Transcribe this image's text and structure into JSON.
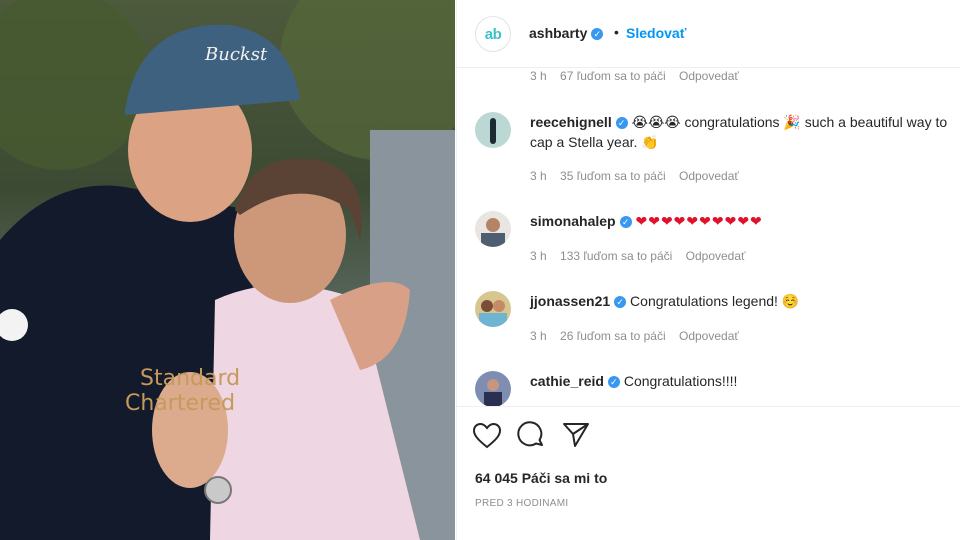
{
  "post": {
    "username": "ashbarty",
    "avatar_text": "ab",
    "separator": "•",
    "follow_label": "Sledovať"
  },
  "first_meta": {
    "time": "3 h",
    "likes": "67 ľuďom sa to páči",
    "reply": "Odpovedať"
  },
  "comments": [
    {
      "username": "reecehignell",
      "text": "😭😭😭 congratulations 🎉 such a beautiful way to cap a Stella year. 👏",
      "time": "3 h",
      "likes": "35 ľuďom sa to páči",
      "reply": "Odpovedať"
    },
    {
      "username": "simonahalep",
      "text": "❤❤❤❤❤❤❤❤❤❤",
      "time": "3 h",
      "likes": "133 ľuďom sa to páči",
      "reply": "Odpovedať"
    },
    {
      "username": "jjonassen21",
      "text": "Congratulations legend! ☺️",
      "time": "3 h",
      "likes": "26 ľuďom sa to páči",
      "reply": "Odpovedať"
    },
    {
      "username": "cathie_reid",
      "text": "Congratulations!!!!"
    }
  ],
  "actions": {
    "like_icon": "heart-icon",
    "comment_icon": "comment-icon",
    "share_icon": "share-icon"
  },
  "likes_total": "64 045 Páči sa mi to",
  "posted_ago": "PRED 3 HODINAMI",
  "colors": {
    "link": "#0095f6",
    "verified": "#3897f0",
    "muted": "#8e8e8e",
    "heart": "#e0112b"
  }
}
